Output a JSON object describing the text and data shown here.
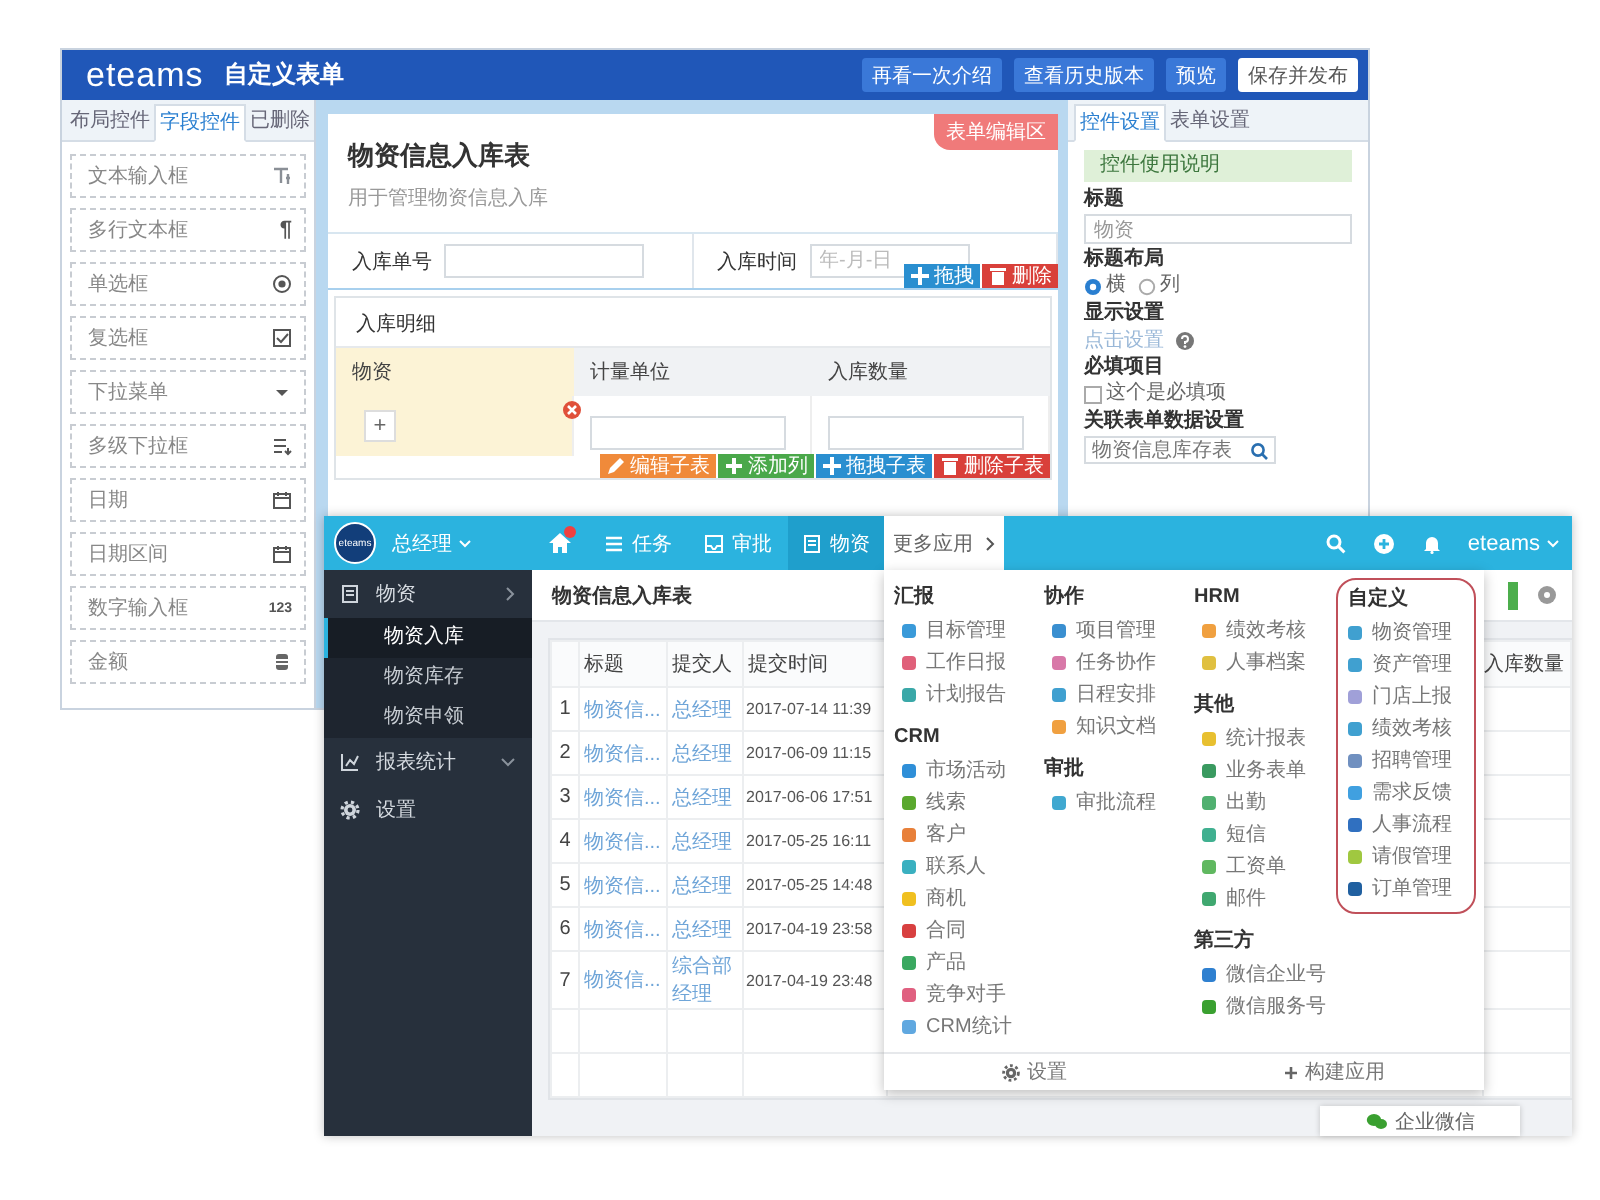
{
  "editor": {
    "logo": "eteams",
    "title": "自定义表单",
    "header_buttons": [
      {
        "label": "再看一次介绍",
        "primary": false
      },
      {
        "label": "查看历史版本",
        "primary": false
      },
      {
        "label": "预览",
        "primary": false
      },
      {
        "label": "保存并发布",
        "primary": true
      }
    ],
    "palette_tabs": [
      {
        "label": "布局控件",
        "selected": false
      },
      {
        "label": "字段控件",
        "selected": true
      },
      {
        "label": "已删除",
        "selected": false
      }
    ],
    "palette_items": [
      {
        "label": "文本输入框",
        "kind": "text"
      },
      {
        "label": "多行文本框",
        "kind": "textarea",
        "glyph": "¶"
      },
      {
        "label": "单选框",
        "kind": "radio"
      },
      {
        "label": "复选框",
        "kind": "checkbox"
      },
      {
        "label": "下拉菜单",
        "kind": "select"
      },
      {
        "label": "多级下拉框",
        "kind": "cascade"
      },
      {
        "label": "日期",
        "kind": "date"
      },
      {
        "label": "日期区间",
        "kind": "daterange"
      },
      {
        "label": "数字输入框",
        "kind": "number",
        "glyph": "123"
      },
      {
        "label": "金额",
        "kind": "money"
      }
    ],
    "form": {
      "tag": "表单编辑区",
      "title": "物资信息入库表",
      "description": "用于管理物资信息入库",
      "fields": [
        {
          "label": "入库单号",
          "kind": "text"
        },
        {
          "label": "入库时间",
          "kind": "date",
          "placeholder": "年-月-日"
        }
      ],
      "field_actions": [
        {
          "label": "拖拽",
          "kind": "drag"
        },
        {
          "label": "删除",
          "kind": "delete"
        }
      ],
      "subtable": {
        "title": "入库明细",
        "columns": [
          {
            "label": "物资",
            "selected": true
          },
          {
            "label": "计量单位",
            "selected": false
          },
          {
            "label": "入库数量",
            "selected": false
          }
        ],
        "add_label": "+",
        "actions": [
          {
            "label": "编辑子表",
            "kind": "edit"
          },
          {
            "label": "添加列",
            "kind": "add"
          },
          {
            "label": "拖拽子表",
            "kind": "drag"
          },
          {
            "label": "删除子表",
            "kind": "delete"
          }
        ]
      }
    },
    "settings": {
      "tabs": [
        {
          "label": "控件设置",
          "selected": true
        },
        {
          "label": "表单设置",
          "selected": false
        }
      ],
      "help": "控件使用说明",
      "title_label": "标题",
      "title_value": "物资",
      "layout_label": "标题布局",
      "layout_options": [
        {
          "label": "横",
          "selected": true
        },
        {
          "label": "列",
          "selected": false
        }
      ],
      "display_label": "显示设置",
      "display_link": "点击设置",
      "required_label": "必填项目",
      "required_option": {
        "label": "这个是必填项",
        "checked": false
      },
      "linked_label": "关联表单数据设置",
      "linked_value": "物资信息库存表"
    }
  },
  "app": {
    "logo": "eteams",
    "user": "总经理",
    "home_badge": true,
    "nav": [
      {
        "label": "任务",
        "kind": "list",
        "selected": false
      },
      {
        "label": "审批",
        "kind": "box",
        "selected": false
      },
      {
        "label": "物资",
        "kind": "doc",
        "selected": true
      }
    ],
    "more_label": "更多应用",
    "account": "eteams",
    "sidebar": [
      {
        "label": "物资",
        "kind": "doc",
        "expanded": true,
        "children": [
          {
            "label": "物资入库",
            "selected": true
          },
          {
            "label": "物资库存",
            "selected": false
          },
          {
            "label": "物资申领",
            "selected": false
          }
        ]
      },
      {
        "label": "报表统计",
        "kind": "chart",
        "expanded": false
      },
      {
        "label": "设置",
        "kind": "gear"
      }
    ],
    "page_title": "物资信息入库表",
    "table": {
      "columns": [
        "标题",
        "提交人",
        "提交时间",
        "入库数量"
      ],
      "rows": [
        {
          "index": "1",
          "title": "物资信...",
          "submitter": "总经理",
          "time": "2017-07-14 11:39"
        },
        {
          "index": "2",
          "title": "物资信...",
          "submitter": "总经理",
          "time": "2017-06-09 11:15"
        },
        {
          "index": "3",
          "title": "物资信...",
          "submitter": "总经理",
          "time": "2017-06-06 17:51"
        },
        {
          "index": "4",
          "title": "物资信...",
          "submitter": "总经理",
          "time": "2017-05-25 16:11"
        },
        {
          "index": "5",
          "title": "物资信...",
          "submitter": "总经理",
          "time": "2017-05-25 14:48"
        },
        {
          "index": "6",
          "title": "物资信...",
          "submitter": "总经理",
          "time": "2017-04-19 23:58"
        },
        {
          "index": "7",
          "title": "物资信...",
          "submitter": "综合部经理",
          "time": "2017-04-19 23:48"
        }
      ]
    },
    "chat_label": "企业微信",
    "apps_menu": {
      "columns": [
        {
          "groups": [
            {
              "title": "汇报",
              "highlighted": false,
              "items": [
                {
                  "label": "目标管理",
                  "color": "#3a9ad9"
                },
                {
                  "label": "工作日报",
                  "color": "#e0607a"
                },
                {
                  "label": "计划报告",
                  "color": "#3aa8a8"
                }
              ]
            },
            {
              "title": "CRM",
              "highlighted": false,
              "items": [
                {
                  "label": "市场活动",
                  "color": "#2f8fd8"
                },
                {
                  "label": "线索",
                  "color": "#5aa82e"
                },
                {
                  "label": "客户",
                  "color": "#e8803a"
                },
                {
                  "label": "联系人",
                  "color": "#3ab0c0"
                },
                {
                  "label": "商机",
                  "color": "#f0c020"
                },
                {
                  "label": "合同",
                  "color": "#d84040"
                },
                {
                  "label": "产品",
                  "color": "#3aa860"
                },
                {
                  "label": "竞争对手",
                  "color": "#e06080"
                },
                {
                  "label": "CRM统计",
                  "color": "#60a8e0"
                }
              ]
            }
          ]
        },
        {
          "groups": [
            {
              "title": "协作",
              "highlighted": false,
              "items": [
                {
                  "label": "项目管理",
                  "color": "#3a8fd0"
                },
                {
                  "label": "任务协作",
                  "color": "#d878a8"
                },
                {
                  "label": "日程安排",
                  "color": "#40a0d0"
                },
                {
                  "label": "知识文档",
                  "color": "#f0a040"
                }
              ]
            },
            {
              "title": "审批",
              "highlighted": false,
              "items": [
                {
                  "label": "审批流程",
                  "color": "#40a8d0"
                }
              ]
            }
          ]
        },
        {
          "groups": [
            {
              "title": "HRM",
              "highlighted": false,
              "items": [
                {
                  "label": "绩效考核",
                  "color": "#f0a040"
                },
                {
                  "label": "人事档案",
                  "color": "#e0c040"
                }
              ]
            },
            {
              "title": "其他",
              "highlighted": false,
              "items": [
                {
                  "label": "统计报表",
                  "color": "#e8c030"
                },
                {
                  "label": "业务表单",
                  "color": "#3a9a60"
                },
                {
                  "label": "出勤",
                  "color": "#50b070"
                },
                {
                  "label": "短信",
                  "color": "#40b090"
                },
                {
                  "label": "工资单",
                  "color": "#60b860"
                },
                {
                  "label": "邮件",
                  "color": "#40a870"
                }
              ]
            },
            {
              "title": "第三方",
              "highlighted": false,
              "items": [
                {
                  "label": "微信企业号",
                  "color": "#2f80d0"
                },
                {
                  "label": "微信服务号",
                  "color": "#3aa030"
                }
              ]
            }
          ]
        },
        {
          "groups": [
            {
              "title": "自定义",
              "highlighted": true,
              "items": [
                {
                  "label": "物资管理",
                  "color": "#40a0d0"
                },
                {
                  "label": "资产管理",
                  "color": "#40a0d0"
                },
                {
                  "label": "门店上报",
                  "color": "#a0a0d8"
                },
                {
                  "label": "绩效考核",
                  "color": "#40a0d0"
                },
                {
                  "label": "招聘管理",
                  "color": "#7090c0"
                },
                {
                  "label": "需求反馈",
                  "color": "#40a0e0"
                },
                {
                  "label": "人事流程",
                  "color": "#3070c0"
                },
                {
                  "label": "请假管理",
                  "color": "#a0c840"
                },
                {
                  "label": "订单管理",
                  "color": "#2060a0"
                }
              ]
            }
          ]
        }
      ],
      "footer": [
        {
          "label": "设置",
          "kind": "settings"
        },
        {
          "label": "构建应用",
          "kind": "build"
        }
      ]
    }
  }
}
